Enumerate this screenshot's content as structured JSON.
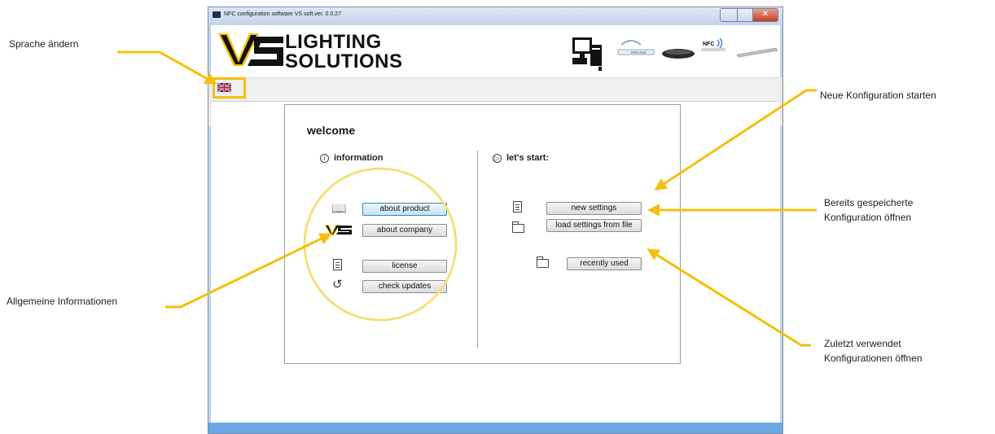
{
  "window": {
    "title": "NFC configuration software VS soft.ver. 0.0.27",
    "logo_line1": "LIGHTING",
    "logo_line2": "SOLUTIONS",
    "header_icons": [
      "computer-icon",
      "enocean-module-icon",
      "nfc-programmer-icon",
      "nfc-tag-icon",
      "led-driver-icon"
    ],
    "language_flag": "uk-flag-icon"
  },
  "welcome": {
    "title": "welcome",
    "information": {
      "heading": "information",
      "buttons": {
        "about_product": "about product",
        "about_company": "about company",
        "license": "license",
        "check_updates": "check updates"
      }
    },
    "start": {
      "heading": "let's start:",
      "buttons": {
        "new_settings": "new settings",
        "load_settings": "load settings from file",
        "recently_used": "recently used"
      }
    }
  },
  "annotations": {
    "change_language": "Sprache ändern",
    "new_configuration": "Neue Konfiguration starten",
    "open_saved_1": "Bereits gespeicherte",
    "open_saved_2": "Konfiguration öffnen",
    "general_info": "Allgemeine Informationen",
    "recent_1": "Zuletzt verwendet",
    "recent_2": "Konfigurationen öffnen"
  },
  "colors": {
    "accent_yellow": "#f3c00b",
    "status_bar": "#6ca7e6",
    "active_button": "#c6e4f7"
  }
}
